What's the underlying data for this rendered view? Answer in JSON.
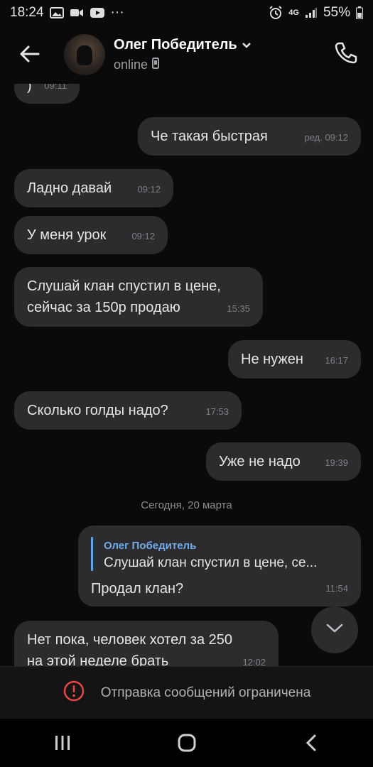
{
  "status_bar": {
    "time": "18:24",
    "dots": "···",
    "network": "4G",
    "battery": "55%"
  },
  "header": {
    "name": "Олег Победитель",
    "status": "online"
  },
  "messages": [
    {
      "side": "in",
      "text": ")",
      "time": "09:11"
    },
    {
      "side": "out",
      "text": "Че такая быстрая",
      "time": "ред. 09:12"
    },
    {
      "side": "in",
      "text": "Ладно давай",
      "time": "09:12"
    },
    {
      "side": "in",
      "text": "У меня урок",
      "time": "09:12"
    },
    {
      "side": "in",
      "text_line1": "Слушай клан спустил в цене,",
      "text_line2": "сейчас за 150р продаю",
      "time": "15:35"
    },
    {
      "side": "out",
      "text": "Не нужен",
      "time": "16:17"
    },
    {
      "side": "in",
      "text": "Сколько голды надо?",
      "time": "17:53"
    },
    {
      "side": "out",
      "text": "Уже не надо",
      "time": "19:39"
    }
  ],
  "date_separator": "Сегодня, 20 марта",
  "reply_message": {
    "reply_to_name": "Олег Победитель",
    "reply_to_text": "Слушай клан спустил в цене, се...",
    "text": "Продал клан?",
    "time": "11:54"
  },
  "last_message": {
    "text_line1": "Нет пока, человек хотел за 250",
    "text_line2": "на этой неделе брать",
    "time": "12:02"
  },
  "restriction_notice": "Отправка сообщений ограничена",
  "colors": {
    "background": "#0a0a0a",
    "bubble": "#2c2c2e",
    "accent": "#71aaeb",
    "warning": "#e64646"
  }
}
